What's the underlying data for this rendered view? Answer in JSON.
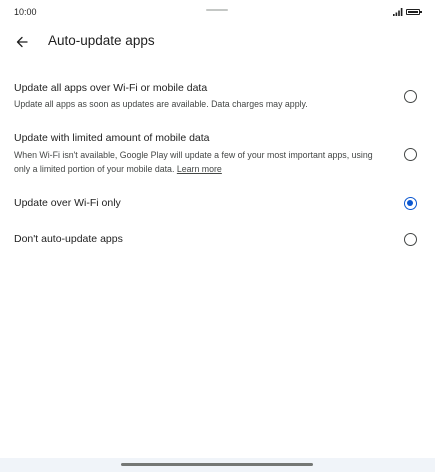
{
  "status_bar": {
    "time": "10:00",
    "icons": [
      "signal-icon",
      "battery-icon"
    ]
  },
  "header": {
    "back_icon": "arrow-left-icon",
    "title": "Auto-update apps"
  },
  "options": [
    {
      "title": "Update all apps over Wi-Fi or mobile data",
      "description": "Update all apps as soon as updates are available. Data charges may apply.",
      "selected": false
    },
    {
      "title": "Update with limited amount of mobile data",
      "description": "When Wi-Fi isn't available, Google Play will update a few of your most important apps, using only a limited portion of your mobile data.",
      "link": "Learn more",
      "selected": false
    },
    {
      "title": "Update over Wi-Fi only",
      "selected": true
    },
    {
      "title": "Don't auto-update apps",
      "selected": false
    }
  ],
  "colors": {
    "accent": "#0b57d0",
    "text_primary": "#1f1f1f",
    "text_secondary": "#444746",
    "nav_bar": "#f0f4f9"
  }
}
